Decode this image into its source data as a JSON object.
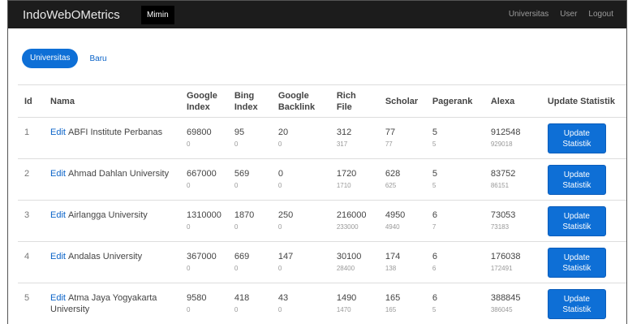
{
  "navbar": {
    "brand": "IndoWebOMetrics",
    "active": "Mimin",
    "right": [
      "Universitas",
      "User",
      "Logout"
    ]
  },
  "pills": {
    "active": "Universitas",
    "other": "Baru"
  },
  "table": {
    "headers": {
      "id": "Id",
      "nama": "Nama",
      "google_index": "Google Index",
      "bing_index": "Bing Index",
      "google_backlink": "Google Backlink",
      "rich_file": "Rich File",
      "scholar": "Scholar",
      "pagerank": "Pagerank",
      "alexa": "Alexa",
      "update": "Update Statistik"
    },
    "edit_label": "Edit",
    "button_label": "Update Statistik",
    "rows": [
      {
        "id": "1",
        "nama": "ABFI Institute Perbanas",
        "google": [
          "69800",
          "0"
        ],
        "bing": [
          "95",
          "0"
        ],
        "backlink": [
          "20",
          "0"
        ],
        "rich": [
          "312",
          "317"
        ],
        "scholar": [
          "77",
          "77"
        ],
        "pagerank": [
          "5",
          "5"
        ],
        "alexa": [
          "912548",
          "929018"
        ]
      },
      {
        "id": "2",
        "nama": "Ahmad Dahlan University",
        "google": [
          "667000",
          "0"
        ],
        "bing": [
          "569",
          "0"
        ],
        "backlink": [
          "0",
          "0"
        ],
        "rich": [
          "1720",
          "1710"
        ],
        "scholar": [
          "628",
          "625"
        ],
        "pagerank": [
          "5",
          "5"
        ],
        "alexa": [
          "83752",
          "86151"
        ]
      },
      {
        "id": "3",
        "nama": "Airlangga University",
        "google": [
          "1310000",
          "0"
        ],
        "bing": [
          "1870",
          "0"
        ],
        "backlink": [
          "250",
          "0"
        ],
        "rich": [
          "216000",
          "233000"
        ],
        "scholar": [
          "4950",
          "4940"
        ],
        "pagerank": [
          "6",
          "7"
        ],
        "alexa": [
          "73053",
          "73183"
        ]
      },
      {
        "id": "4",
        "nama": "Andalas University",
        "google": [
          "367000",
          "0"
        ],
        "bing": [
          "669",
          "0"
        ],
        "backlink": [
          "147",
          "0"
        ],
        "rich": [
          "30100",
          "28400"
        ],
        "scholar": [
          "174",
          "138"
        ],
        "pagerank": [
          "6",
          "6"
        ],
        "alexa": [
          "176038",
          "172491"
        ]
      },
      {
        "id": "5",
        "nama": "Atma Jaya Yogyakarta University",
        "google": [
          "9580",
          "0"
        ],
        "bing": [
          "418",
          "0"
        ],
        "backlink": [
          "43",
          "0"
        ],
        "rich": [
          "1490",
          "1470"
        ],
        "scholar": [
          "165",
          "165"
        ],
        "pagerank": [
          "6",
          "5"
        ],
        "alexa": [
          "388845",
          "386045"
        ]
      }
    ]
  }
}
